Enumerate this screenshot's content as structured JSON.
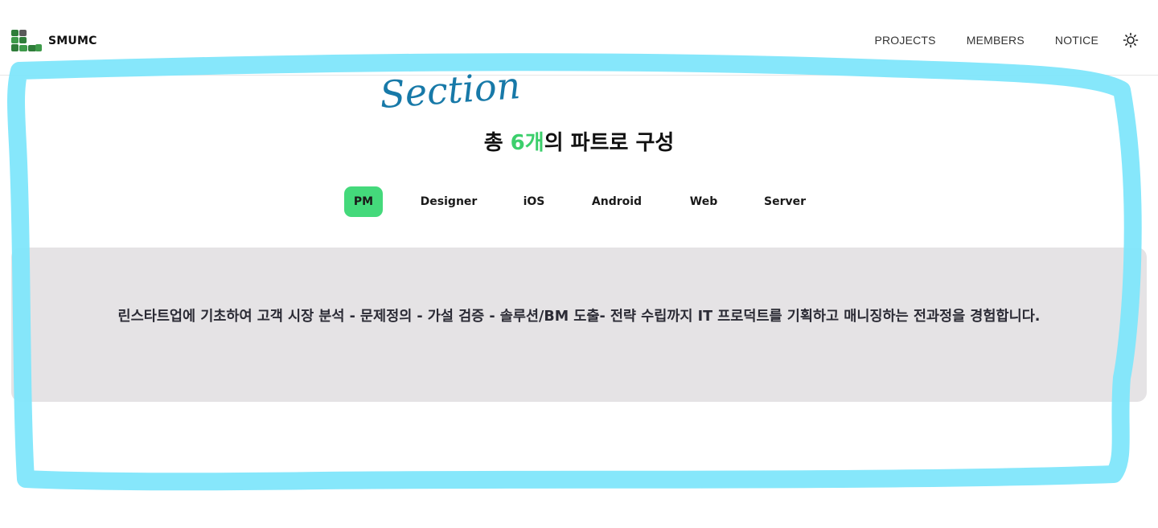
{
  "header": {
    "brand_name": "SMUMC",
    "nav": {
      "projects": "PROJECTS",
      "members": "MEMBERS",
      "notice": "NOTICE"
    },
    "theme_icon": "sun-icon",
    "logo_icon": "smumc-logo"
  },
  "section": {
    "title_prefix": "총 ",
    "title_accent": "6개",
    "title_suffix": "의 파트로 구성",
    "tabs": [
      {
        "label": "PM",
        "active": true
      },
      {
        "label": "Designer",
        "active": false
      },
      {
        "label": "iOS",
        "active": false
      },
      {
        "label": "Android",
        "active": false
      },
      {
        "label": "Web",
        "active": false
      },
      {
        "label": "Server",
        "active": false
      }
    ],
    "description": "린스타트업에 기초하여 고객 시장 분석 - 문제정의 - 가설 검증 - 솔루션/BM 도출- 전략 수립까지 IT 프로덕트를 기획하고 매니징하는 전과정을 경험합니다."
  },
  "annotation": {
    "label": "Section",
    "color": "#7fe6fb",
    "text_color": "#1779a8"
  },
  "colors": {
    "accent": "#3ccf6c",
    "active_tab": "#44d97b",
    "desc_bg": "#e5e3e5"
  }
}
